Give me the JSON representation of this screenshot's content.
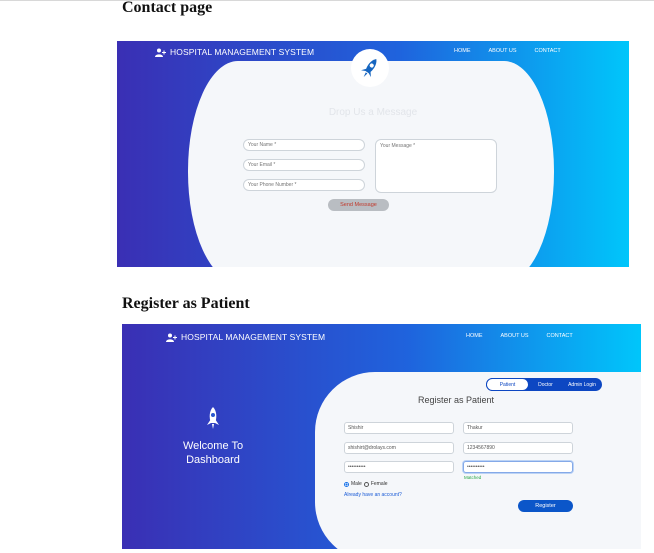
{
  "contact_section": {
    "heading": "Contact page",
    "brand": "HOSPITAL MANAGEMENT SYSTEM",
    "nav": [
      "HOME",
      "ABOUT US",
      "CONTACT"
    ],
    "form_title": "Drop Us a Message",
    "name_placeholder": "Your Name *",
    "email_placeholder": "Your Email *",
    "phone_placeholder": "Your Phone Number *",
    "message_placeholder": "Your Message *",
    "send_label": "Send Message"
  },
  "register_section": {
    "heading": "Register as Patient",
    "brand": "HOSPITAL MANAGEMENT SYSTEM",
    "nav": [
      "HOME",
      "ABOUT US",
      "CONTACT"
    ],
    "welcome": "Welcome To Dashboard",
    "tabs": [
      "Patient",
      "Doctor",
      "Admin Login"
    ],
    "active_tab": "Patient",
    "form_title": "Register as Patient",
    "first_name": "Shishir",
    "last_name": "Thakur",
    "email": "shishirt@drolays.com",
    "phone": "1234567890",
    "password": "••••••••••",
    "confirm_password": "••••••••••",
    "match_status": "Matched",
    "gender_male": "Male",
    "gender_female": "Female",
    "selected_gender": "Male",
    "account_link": "Already have an account?",
    "register_label": "Register"
  },
  "colors": {
    "gradient_start": "#3a2fb4",
    "gradient_end": "#00c6fb",
    "accent": "#0b56c9",
    "success": "#28a745"
  },
  "icons": [
    "user-plus-icon",
    "rocket-icon"
  ]
}
